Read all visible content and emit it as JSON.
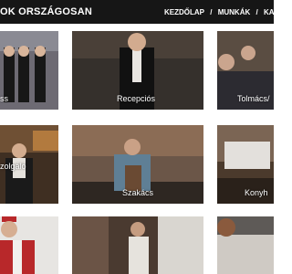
{
  "header": {
    "site_title": "OK ORSZÁGOSAN",
    "nav": [
      "KEZDŐLAP",
      "MUNKÁK",
      "KAPCS"
    ],
    "separator": "/"
  },
  "tiles": [
    {
      "label": "ss",
      "row": 0,
      "col": 0
    },
    {
      "label": "Recepciós",
      "row": 0,
      "col": 1
    },
    {
      "label": "Tolmács/",
      "row": 0,
      "col": 2
    },
    {
      "label": "zolgáló",
      "row": 1,
      "col": 0
    },
    {
      "label": "Szakács",
      "row": 1,
      "col": 1
    },
    {
      "label": "Konyh",
      "row": 1,
      "col": 2
    },
    {
      "label": "",
      "row": 2,
      "col": 0
    },
    {
      "label": "",
      "row": 2,
      "col": 1
    },
    {
      "label": "",
      "row": 2,
      "col": 2
    }
  ],
  "colors": {
    "header_bg": "#161616",
    "text_white": "#ffffff"
  }
}
